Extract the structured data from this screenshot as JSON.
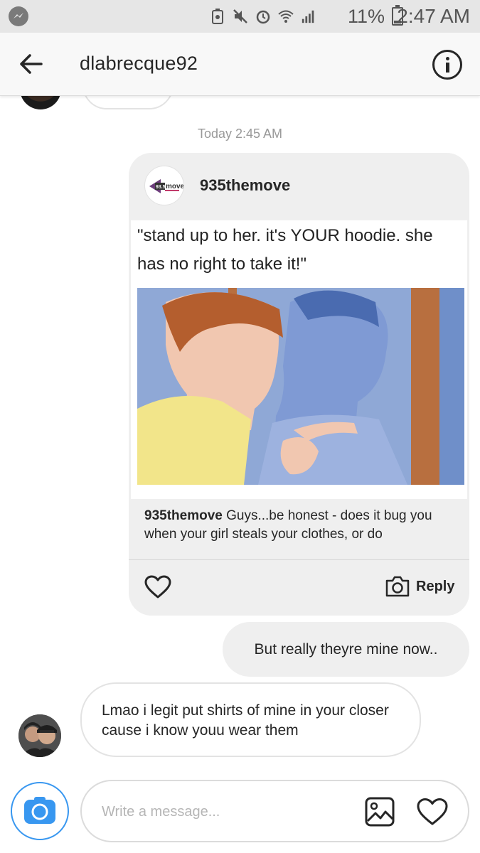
{
  "status_bar": {
    "battery_percent": "11%",
    "time": "2:47 AM",
    "icons": [
      "messenger-icon",
      "battery-saver-icon",
      "mute-icon",
      "alarm-icon",
      "wifi-icon",
      "signal-icon",
      "battery-icon"
    ]
  },
  "header": {
    "username": "dlabrecque92"
  },
  "conversation": {
    "timestamp": "Today 2:45 AM",
    "shared_post": {
      "account": "935themove",
      "logo_text": "935 move",
      "meme_text": "\"stand up to her. it's YOUR hoodie. she has no right to take it!\"",
      "caption_user": "935themove",
      "caption_text": " Guys...be honest - does it bug you when your girl steals your clothes, or do",
      "reply_label": "Reply"
    },
    "my_message": "But really theyre mine now..",
    "their_message": "Lmao i legit put shirts of mine in your closer cause i know youu wear them"
  },
  "composer": {
    "placeholder": "Write a message..."
  },
  "colors": {
    "accent_blue": "#3897f0",
    "bubble_gray": "#efefef",
    "text": "#262626"
  }
}
